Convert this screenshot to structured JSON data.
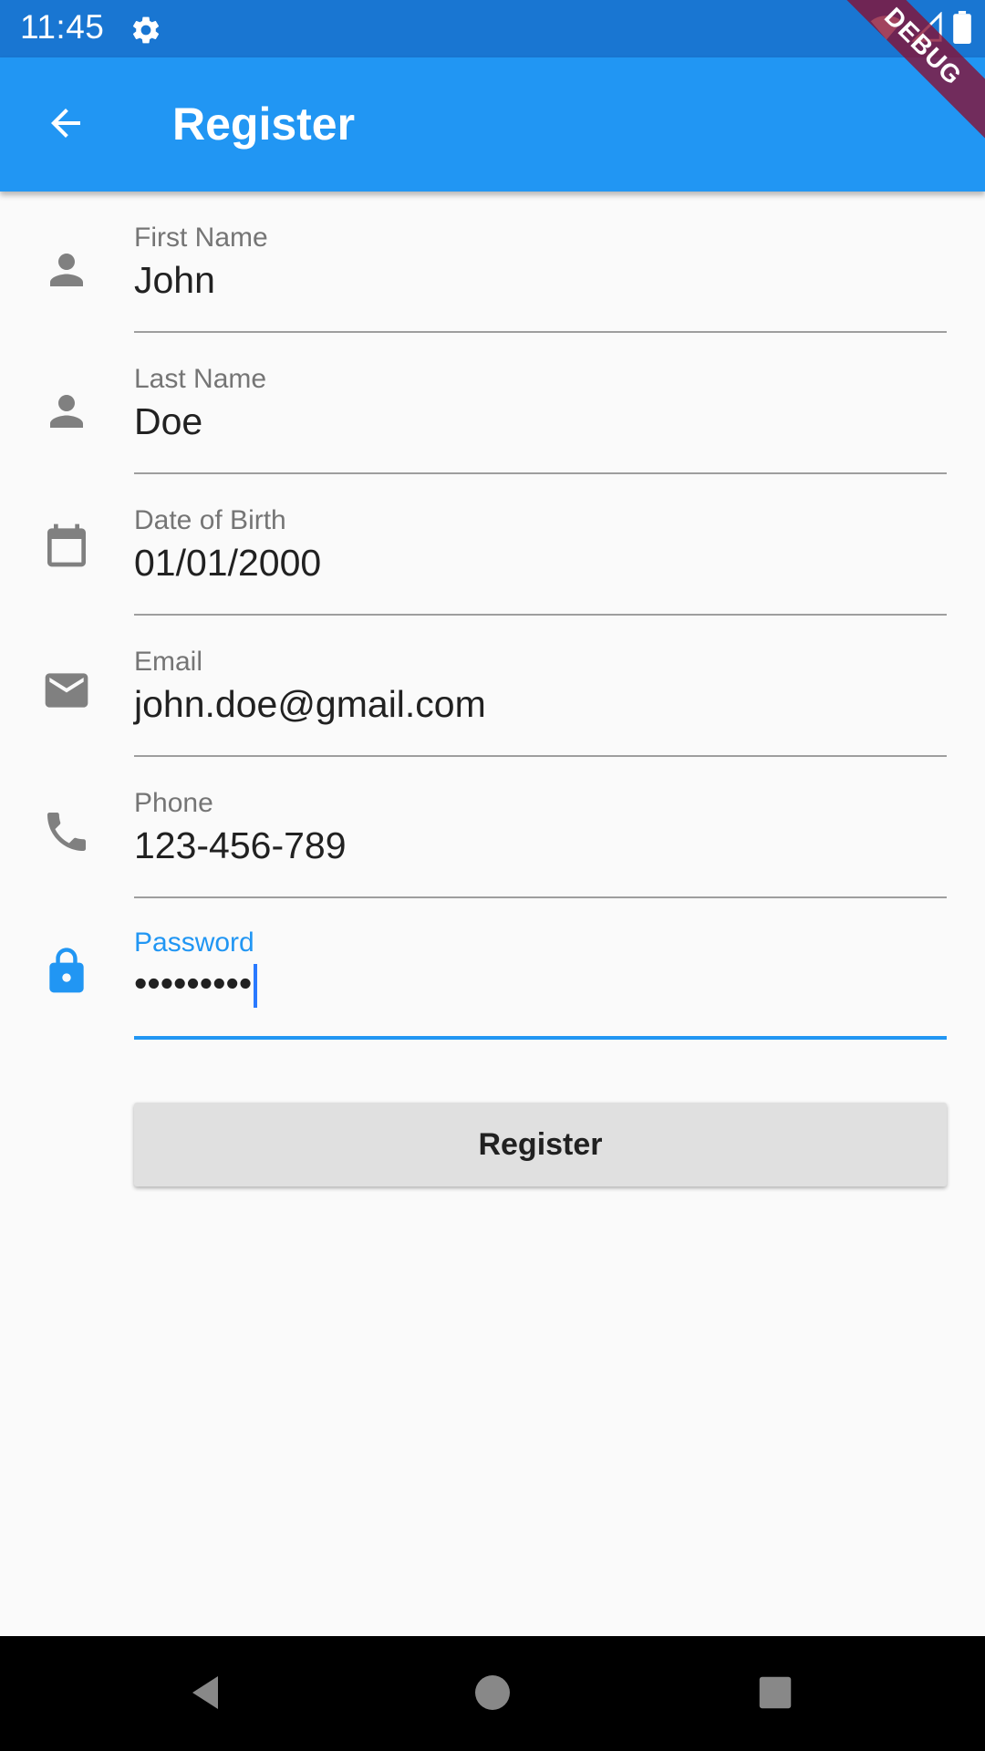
{
  "status_bar": {
    "time": "11:45"
  },
  "app_bar": {
    "title": "Register"
  },
  "debug_banner": "DEBUG",
  "form": {
    "fields": [
      {
        "label": "First Name",
        "value": "John",
        "icon": "person-icon"
      },
      {
        "label": "Last Name",
        "value": "Doe",
        "icon": "person-icon"
      },
      {
        "label": "Date of Birth",
        "value": "01/01/2000",
        "icon": "calendar-icon"
      },
      {
        "label": "Email",
        "value": "john.doe@gmail.com",
        "icon": "email-icon"
      },
      {
        "label": "Phone",
        "value": "123-456-789",
        "icon": "phone-icon"
      },
      {
        "label": "Password",
        "value": "•••••••••",
        "icon": "lock-icon",
        "focused": true
      }
    ],
    "submit_label": "Register"
  },
  "colors": {
    "primary": "#2196F3",
    "primary_dark": "#1976D2",
    "focus_cursor": "#2979FF",
    "debug_ribbon": "#880E31"
  }
}
